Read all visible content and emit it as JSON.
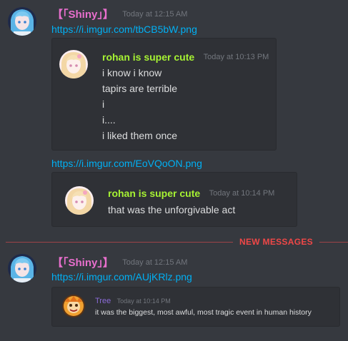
{
  "colors": {
    "background": "#36393f",
    "embed_background": "#2f3136",
    "link": "#00b0f4",
    "shiny_name": "#e86fcd",
    "rohan_name": "#a7f333",
    "tree_name": "#8a6bd6",
    "timestamp": "#72767d",
    "new_messages": "#f04747"
  },
  "messages": [
    {
      "author": "【「Shiny」】",
      "timestamp": "Today at 12:15 AM",
      "link": "https://i.imgur.com/tbCB5bW.png",
      "avatar_icon": "anime-girl-blue-hair-avatar",
      "quote": {
        "author": "rohan is super cute",
        "timestamp": "Today at 10:13 PM",
        "avatar_icon": "anime-girl-blonde-avatar",
        "lines": [
          "i know i know",
          "tapirs are terrible",
          "i",
          "i....",
          "i liked them once"
        ]
      },
      "link2": "https://i.imgur.com/EoVQoON.png",
      "quote2": {
        "author": "rohan is super cute",
        "timestamp": "Today at 10:14 PM",
        "avatar_icon": "anime-girl-blonde-avatar",
        "lines": [
          "that was the unforgivable act"
        ]
      }
    }
  ],
  "divider": {
    "label": "NEW MESSAGES"
  },
  "new_message": {
    "author": "【「Shiny」】",
    "timestamp": "Today at 12:15 AM",
    "link": "https://i.imgur.com/AUjKRlz.png",
    "avatar_icon": "anime-girl-blue-hair-avatar",
    "quote": {
      "author": "Tree",
      "timestamp": "Today at 10:14 PM",
      "avatar_icon": "cartoon-character-avatar",
      "text": "it was the biggest, most awful, most tragic event in human history"
    }
  }
}
